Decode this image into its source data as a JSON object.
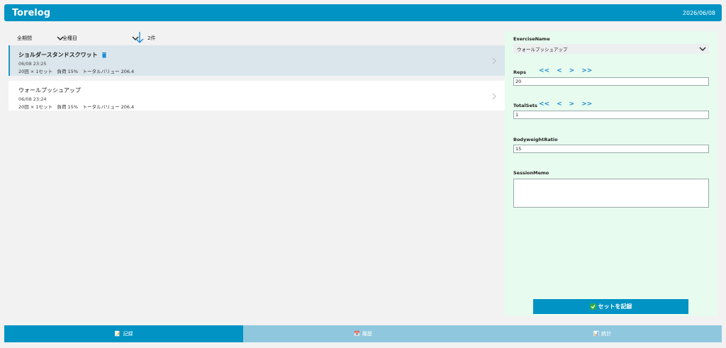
{
  "header": {
    "title": "Torelog",
    "date": "2026/06/08"
  },
  "filters": {
    "period": "全期間",
    "category": "全種目",
    "count": "2件"
  },
  "list": [
    {
      "name": "ショルダースタンドスクワット",
      "when": "06/08 23:25",
      "stats": "20回 × 1セット　負荷 15%　トータルバリュー 206.4"
    },
    {
      "name": "ウォールプッシュアップ",
      "when": "06/08 23:24",
      "stats": "20回 × 1セット　負荷 15%　トータルバリュー 206.4"
    }
  ],
  "form": {
    "exercise_label": "ExerciseName",
    "exercise_value": "ウォールプッシュアップ",
    "reps_label": "Reps",
    "reps_value": "20",
    "sets_label": "TotalSets",
    "sets_value": "1",
    "ratio_label": "BodyweightRatio",
    "ratio_value": "15",
    "memo_label": "SessionMemo",
    "nav": {
      "first": "<<",
      "prev": "<",
      "next": ">",
      "last": ">>"
    },
    "record_button": "セットを記録"
  },
  "tabs": [
    {
      "label": "記録",
      "icon": "📝"
    },
    {
      "label": "履歴",
      "icon": "📅"
    },
    {
      "label": "統計",
      "icon": "📊"
    }
  ],
  "colors": {
    "accent": "#0093c4",
    "tab_inactive": "#8fc8de",
    "panel_bg": "#e8fbef",
    "selected_row": "#dae6ec",
    "nav_arrows": "#1b8ad0"
  }
}
